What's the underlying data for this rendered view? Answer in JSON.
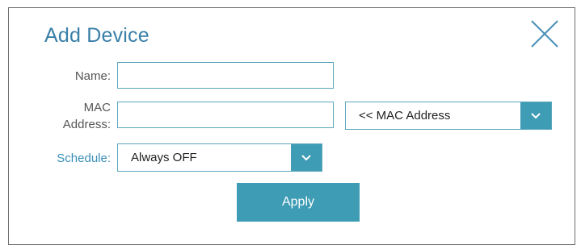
{
  "dialog": {
    "title": "Add Device",
    "close_icon": "close-icon"
  },
  "form": {
    "name_label": "Name:",
    "name_value": "",
    "mac_label_line1": "MAC",
    "mac_label_line2": "Address:",
    "mac_value": "",
    "mac_select_value": "<< MAC Address",
    "schedule_label": "Schedule:",
    "schedule_value": "Always OFF",
    "apply_label": "Apply"
  },
  "colors": {
    "accent": "#3e9cb4",
    "title": "#3a7fa8",
    "border": "#5aa7bd"
  }
}
